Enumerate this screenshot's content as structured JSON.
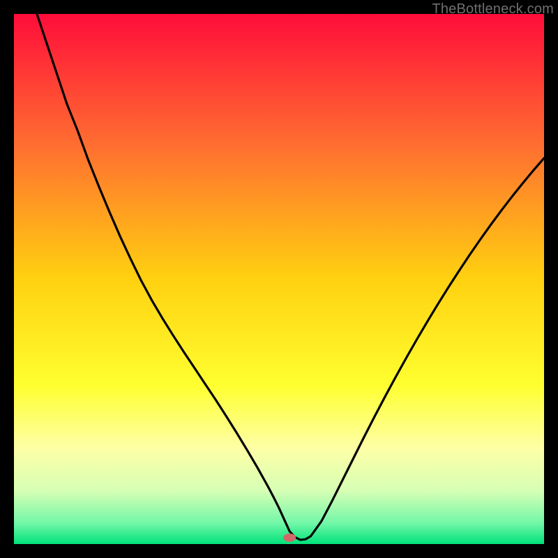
{
  "watermark": "TheBottleneck.com",
  "chart_data": {
    "type": "line",
    "title": "",
    "xlabel": "",
    "ylabel": "",
    "xlim": [
      0,
      100
    ],
    "ylim": [
      0,
      100
    ],
    "gradient": {
      "stops": [
        {
          "offset": 0.0,
          "color": "#ff0d3a"
        },
        {
          "offset": 0.25,
          "color": "#ff6f30"
        },
        {
          "offset": 0.5,
          "color": "#ffd110"
        },
        {
          "offset": 0.7,
          "color": "#ffff2f"
        },
        {
          "offset": 0.82,
          "color": "#fdffa7"
        },
        {
          "offset": 0.9,
          "color": "#d6ffb5"
        },
        {
          "offset": 0.96,
          "color": "#73f7a8"
        },
        {
          "offset": 1.0,
          "color": "#00e27a"
        }
      ]
    },
    "marker": {
      "x": 52,
      "y": 1.2,
      "color": "#d06a6a"
    },
    "x": [
      0,
      2,
      4,
      6,
      8,
      10,
      12,
      14,
      16,
      18,
      20,
      22,
      24,
      26,
      28,
      30,
      32,
      34,
      36,
      38,
      40,
      42,
      44,
      46,
      48,
      49,
      50,
      51,
      52,
      53,
      54,
      55,
      56,
      58,
      60,
      62,
      64,
      66,
      68,
      70,
      72,
      74,
      76,
      78,
      80,
      82,
      84,
      86,
      88,
      90,
      92,
      94,
      96,
      98,
      100
    ],
    "values": [
      115,
      108,
      101,
      95,
      89,
      83,
      78,
      72.5,
      67.5,
      62.7,
      58.1,
      53.8,
      49.7,
      46,
      42.6,
      39.4,
      36.3,
      33.3,
      30.3,
      27.3,
      24.2,
      21,
      17.7,
      14.3,
      10.7,
      8.8,
      6.8,
      4.6,
      2.4,
      1.3,
      0.8,
      0.9,
      1.5,
      4.3,
      8.1,
      12.1,
      16.1,
      20.1,
      24,
      27.8,
      31.5,
      35.1,
      38.6,
      42,
      45.3,
      48.5,
      51.6,
      54.6,
      57.5,
      60.3,
      63,
      65.6,
      68.1,
      70.5,
      72.8
    ]
  }
}
